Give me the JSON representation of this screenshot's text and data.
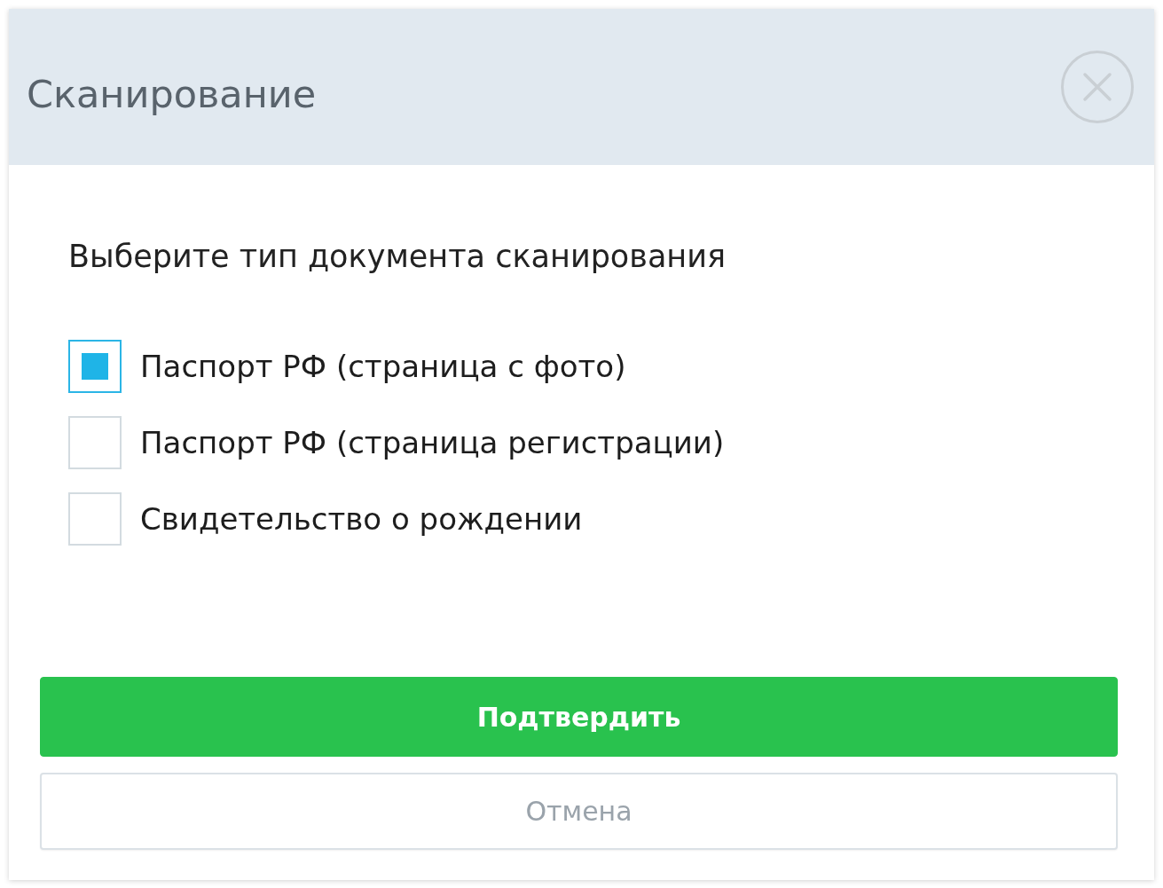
{
  "dialog": {
    "title": "Сканирование",
    "prompt": "Выберите тип документа сканирования",
    "options": [
      {
        "label": "Паспорт РФ (страница с фото)",
        "checked": true
      },
      {
        "label": "Паспорт РФ (страница регистрации)",
        "checked": false
      },
      {
        "label": "Свидетельство о рождении",
        "checked": false
      }
    ],
    "buttons": [
      {
        "label": "Подтвердить",
        "kind": "primary"
      },
      {
        "label": "Отмена",
        "kind": "secondary"
      }
    ]
  }
}
